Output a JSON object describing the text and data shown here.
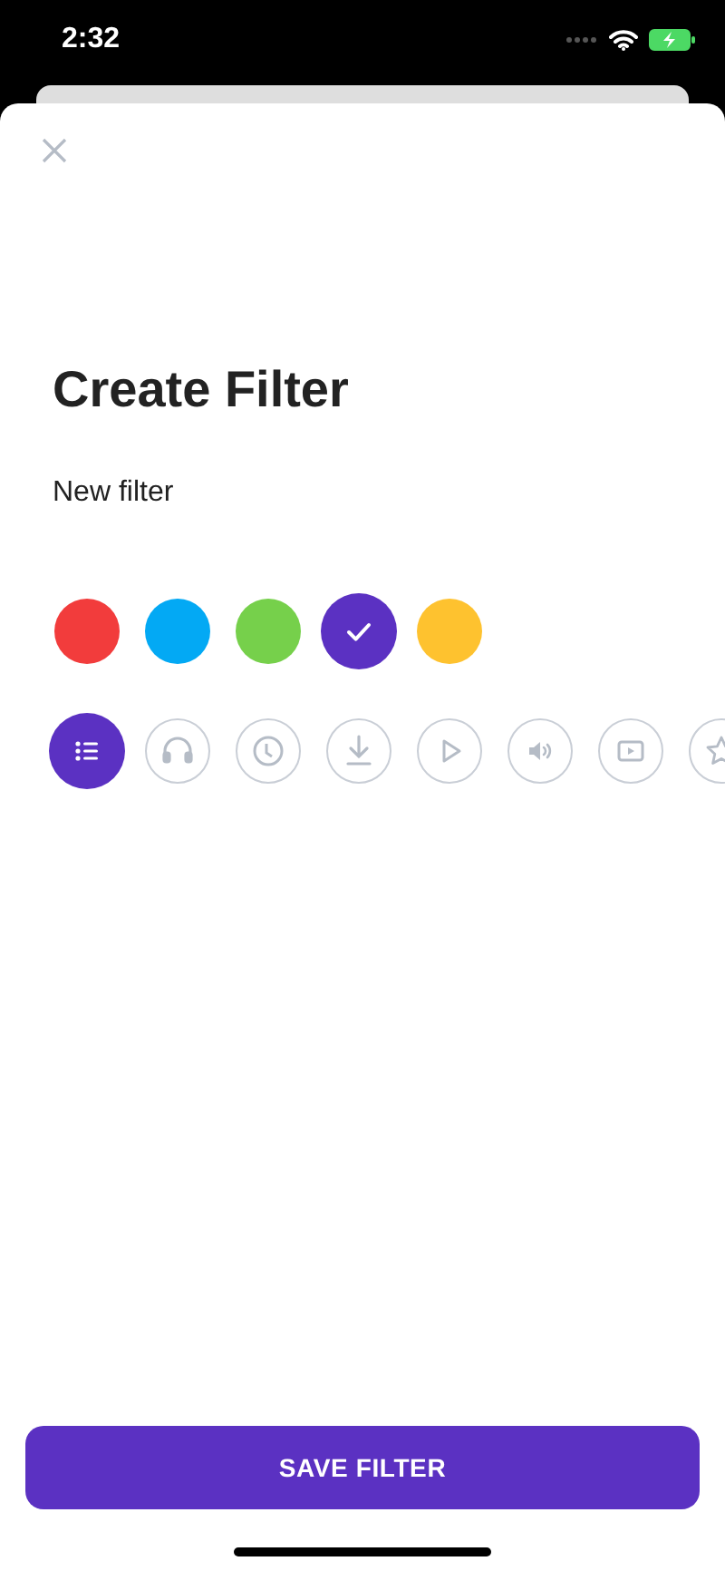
{
  "status_bar": {
    "time": "2:32"
  },
  "title": "Create Filter",
  "name_field": {
    "value": "New filter"
  },
  "colors": [
    {
      "color": "#f23c3c",
      "selected": false
    },
    {
      "color": "#03a9f4",
      "selected": false
    },
    {
      "color": "#76d04b",
      "selected": false
    },
    {
      "color": "#5b31c2",
      "selected": true
    },
    {
      "color": "#fec22f",
      "selected": false
    }
  ],
  "icons": [
    {
      "kind": "list",
      "selected": true
    },
    {
      "kind": "headphones",
      "selected": false
    },
    {
      "kind": "clock",
      "selected": false
    },
    {
      "kind": "download",
      "selected": false
    },
    {
      "kind": "play",
      "selected": false
    },
    {
      "kind": "speaker",
      "selected": false
    },
    {
      "kind": "video",
      "selected": false
    },
    {
      "kind": "star",
      "selected": false
    }
  ],
  "save_button": "SAVE FILTER"
}
